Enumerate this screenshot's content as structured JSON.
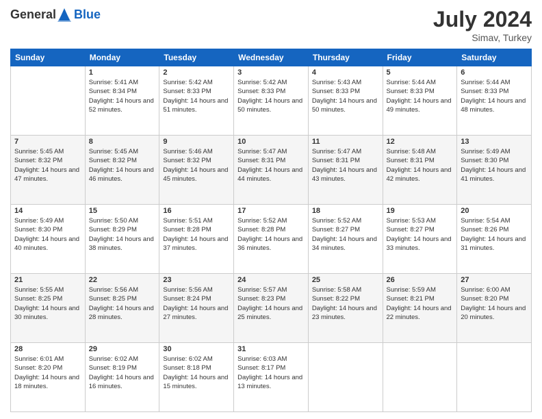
{
  "header": {
    "logo_general": "General",
    "logo_blue": "Blue",
    "month_year": "July 2024",
    "location": "Simav, Turkey"
  },
  "days_of_week": [
    "Sunday",
    "Monday",
    "Tuesday",
    "Wednesday",
    "Thursday",
    "Friday",
    "Saturday"
  ],
  "weeks": [
    [
      {
        "day": "",
        "sunrise": "",
        "sunset": "",
        "daylight": ""
      },
      {
        "day": "1",
        "sunrise": "Sunrise: 5:41 AM",
        "sunset": "Sunset: 8:34 PM",
        "daylight": "Daylight: 14 hours and 52 minutes."
      },
      {
        "day": "2",
        "sunrise": "Sunrise: 5:42 AM",
        "sunset": "Sunset: 8:33 PM",
        "daylight": "Daylight: 14 hours and 51 minutes."
      },
      {
        "day": "3",
        "sunrise": "Sunrise: 5:42 AM",
        "sunset": "Sunset: 8:33 PM",
        "daylight": "Daylight: 14 hours and 50 minutes."
      },
      {
        "day": "4",
        "sunrise": "Sunrise: 5:43 AM",
        "sunset": "Sunset: 8:33 PM",
        "daylight": "Daylight: 14 hours and 50 minutes."
      },
      {
        "day": "5",
        "sunrise": "Sunrise: 5:44 AM",
        "sunset": "Sunset: 8:33 PM",
        "daylight": "Daylight: 14 hours and 49 minutes."
      },
      {
        "day": "6",
        "sunrise": "Sunrise: 5:44 AM",
        "sunset": "Sunset: 8:33 PM",
        "daylight": "Daylight: 14 hours and 48 minutes."
      }
    ],
    [
      {
        "day": "7",
        "sunrise": "Sunrise: 5:45 AM",
        "sunset": "Sunset: 8:32 PM",
        "daylight": "Daylight: 14 hours and 47 minutes."
      },
      {
        "day": "8",
        "sunrise": "Sunrise: 5:45 AM",
        "sunset": "Sunset: 8:32 PM",
        "daylight": "Daylight: 14 hours and 46 minutes."
      },
      {
        "day": "9",
        "sunrise": "Sunrise: 5:46 AM",
        "sunset": "Sunset: 8:32 PM",
        "daylight": "Daylight: 14 hours and 45 minutes."
      },
      {
        "day": "10",
        "sunrise": "Sunrise: 5:47 AM",
        "sunset": "Sunset: 8:31 PM",
        "daylight": "Daylight: 14 hours and 44 minutes."
      },
      {
        "day": "11",
        "sunrise": "Sunrise: 5:47 AM",
        "sunset": "Sunset: 8:31 PM",
        "daylight": "Daylight: 14 hours and 43 minutes."
      },
      {
        "day": "12",
        "sunrise": "Sunrise: 5:48 AM",
        "sunset": "Sunset: 8:31 PM",
        "daylight": "Daylight: 14 hours and 42 minutes."
      },
      {
        "day": "13",
        "sunrise": "Sunrise: 5:49 AM",
        "sunset": "Sunset: 8:30 PM",
        "daylight": "Daylight: 14 hours and 41 minutes."
      }
    ],
    [
      {
        "day": "14",
        "sunrise": "Sunrise: 5:49 AM",
        "sunset": "Sunset: 8:30 PM",
        "daylight": "Daylight: 14 hours and 40 minutes."
      },
      {
        "day": "15",
        "sunrise": "Sunrise: 5:50 AM",
        "sunset": "Sunset: 8:29 PM",
        "daylight": "Daylight: 14 hours and 38 minutes."
      },
      {
        "day": "16",
        "sunrise": "Sunrise: 5:51 AM",
        "sunset": "Sunset: 8:28 PM",
        "daylight": "Daylight: 14 hours and 37 minutes."
      },
      {
        "day": "17",
        "sunrise": "Sunrise: 5:52 AM",
        "sunset": "Sunset: 8:28 PM",
        "daylight": "Daylight: 14 hours and 36 minutes."
      },
      {
        "day": "18",
        "sunrise": "Sunrise: 5:52 AM",
        "sunset": "Sunset: 8:27 PM",
        "daylight": "Daylight: 14 hours and 34 minutes."
      },
      {
        "day": "19",
        "sunrise": "Sunrise: 5:53 AM",
        "sunset": "Sunset: 8:27 PM",
        "daylight": "Daylight: 14 hours and 33 minutes."
      },
      {
        "day": "20",
        "sunrise": "Sunrise: 5:54 AM",
        "sunset": "Sunset: 8:26 PM",
        "daylight": "Daylight: 14 hours and 31 minutes."
      }
    ],
    [
      {
        "day": "21",
        "sunrise": "Sunrise: 5:55 AM",
        "sunset": "Sunset: 8:25 PM",
        "daylight": "Daylight: 14 hours and 30 minutes."
      },
      {
        "day": "22",
        "sunrise": "Sunrise: 5:56 AM",
        "sunset": "Sunset: 8:25 PM",
        "daylight": "Daylight: 14 hours and 28 minutes."
      },
      {
        "day": "23",
        "sunrise": "Sunrise: 5:56 AM",
        "sunset": "Sunset: 8:24 PM",
        "daylight": "Daylight: 14 hours and 27 minutes."
      },
      {
        "day": "24",
        "sunrise": "Sunrise: 5:57 AM",
        "sunset": "Sunset: 8:23 PM",
        "daylight": "Daylight: 14 hours and 25 minutes."
      },
      {
        "day": "25",
        "sunrise": "Sunrise: 5:58 AM",
        "sunset": "Sunset: 8:22 PM",
        "daylight": "Daylight: 14 hours and 23 minutes."
      },
      {
        "day": "26",
        "sunrise": "Sunrise: 5:59 AM",
        "sunset": "Sunset: 8:21 PM",
        "daylight": "Daylight: 14 hours and 22 minutes."
      },
      {
        "day": "27",
        "sunrise": "Sunrise: 6:00 AM",
        "sunset": "Sunset: 8:20 PM",
        "daylight": "Daylight: 14 hours and 20 minutes."
      }
    ],
    [
      {
        "day": "28",
        "sunrise": "Sunrise: 6:01 AM",
        "sunset": "Sunset: 8:20 PM",
        "daylight": "Daylight: 14 hours and 18 minutes."
      },
      {
        "day": "29",
        "sunrise": "Sunrise: 6:02 AM",
        "sunset": "Sunset: 8:19 PM",
        "daylight": "Daylight: 14 hours and 16 minutes."
      },
      {
        "day": "30",
        "sunrise": "Sunrise: 6:02 AM",
        "sunset": "Sunset: 8:18 PM",
        "daylight": "Daylight: 14 hours and 15 minutes."
      },
      {
        "day": "31",
        "sunrise": "Sunrise: 6:03 AM",
        "sunset": "Sunset: 8:17 PM",
        "daylight": "Daylight: 14 hours and 13 minutes."
      },
      {
        "day": "",
        "sunrise": "",
        "sunset": "",
        "daylight": ""
      },
      {
        "day": "",
        "sunrise": "",
        "sunset": "",
        "daylight": ""
      },
      {
        "day": "",
        "sunrise": "",
        "sunset": "",
        "daylight": ""
      }
    ]
  ]
}
